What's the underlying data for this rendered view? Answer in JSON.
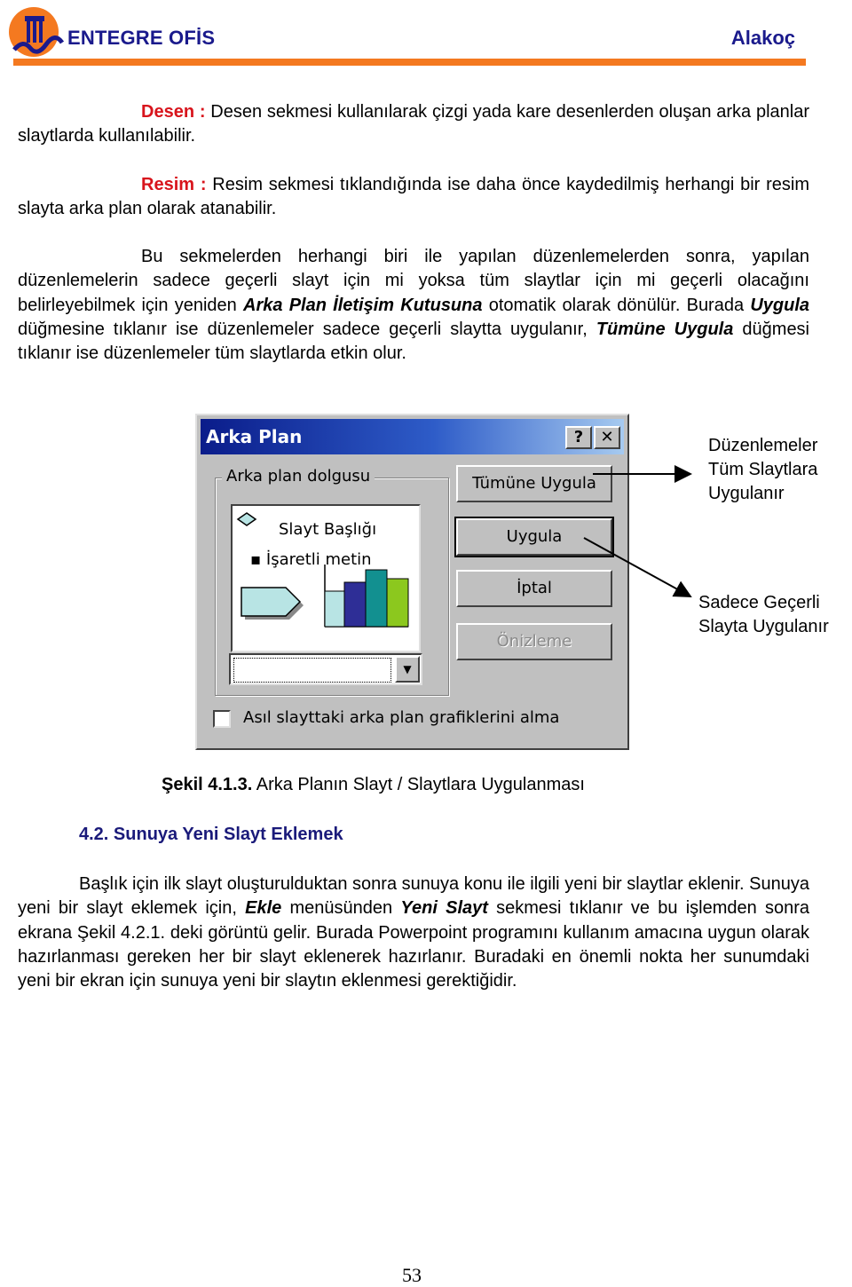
{
  "header": {
    "brand": "ENTEGRE OFİS",
    "author": "Alakoç",
    "logo_icon": "university-logo-icon",
    "accent_color": "#f47920",
    "brand_color": "#1a1a8c"
  },
  "paragraphs": {
    "desen": {
      "label": "Desen :",
      "text": " Desen sekmesi kullanılarak çizgi yada kare desenlerden oluşan arka planlar slaytlarda kullanılabilir."
    },
    "resim": {
      "label": "Resim :",
      "text": " Resim sekmesi tıklandığında ise daha önce kaydedilmiş herhangi bir resim slayta arka plan olarak atanabilir."
    },
    "bu": {
      "t1": "Bu sekmelerden herhangi biri ile yapılan düzenlemelerden sonra, yapılan düzenlemelerin sadece geçerli slayt için mi yoksa tüm slaytlar için mi geçerli olacağını belirleyebilmek için yeniden ",
      "b1": "Arka Plan İletişim Kutusuna",
      "t2": " otomatik olarak dönülür. Burada ",
      "b2": "Uygula",
      "t3": " düğmesine tıklanır ise düzenlemeler sadece geçerli slaytta uygulanır, ",
      "b3": "Tümüne Uygula",
      "t4": " düğmesi tıklanır ise düzenlemeler tüm slaytlarda etkin olur."
    }
  },
  "dialog": {
    "title": "Arka Plan",
    "help_button": "?",
    "close_button": "✕",
    "group_label": "Arka plan dolgusu",
    "preview_title": "Slayt Başlığı",
    "preview_bullet": "▪ İşaretli metin",
    "buttons": {
      "apply_all": "Tümüne Uygula",
      "apply": "Uygula",
      "cancel": "İptal",
      "preview": "Önizleme"
    },
    "checkbox_label": "Asıl slayttaki arka plan grafiklerini alma",
    "checkbox_checked": false,
    "combo_value": ""
  },
  "callouts": {
    "all": [
      "Düzenlemeler",
      "Tüm Slaytlara",
      "Uygulanır"
    ],
    "current": [
      "Sadece Geçerli",
      "Slayta Uygulanır"
    ]
  },
  "caption": {
    "bold": "Şekil 4.1.3.",
    "text": " Arka Planın Slayt / Slaytlara Uygulanması"
  },
  "section": {
    "heading": "4.2. Sunuya Yeni Slayt Eklemek",
    "t1": "Başlık için ilk slayt oluşturulduktan sonra sunuya konu ile ilgili yeni bir slaytlar eklenir. Sunuya yeni bir slayt eklemek için, ",
    "b1": "Ekle",
    "t2": " menüsünden ",
    "b2": "Yeni Slayt",
    "t3": "  sekmesi tıklanır ve bu işlemden sonra ekrana Şekil 4.2.1. deki görüntü gelir. Burada Powerpoint programını kullanım amacına uygun olarak hazırlanması gereken her bir slayt eklenerek hazırlanır. Buradaki en önemli nokta her sunumdaki yeni bir ekran için sunuya yeni bir slaytın eklenmesi gerektiğidir."
  },
  "page_number": "53"
}
